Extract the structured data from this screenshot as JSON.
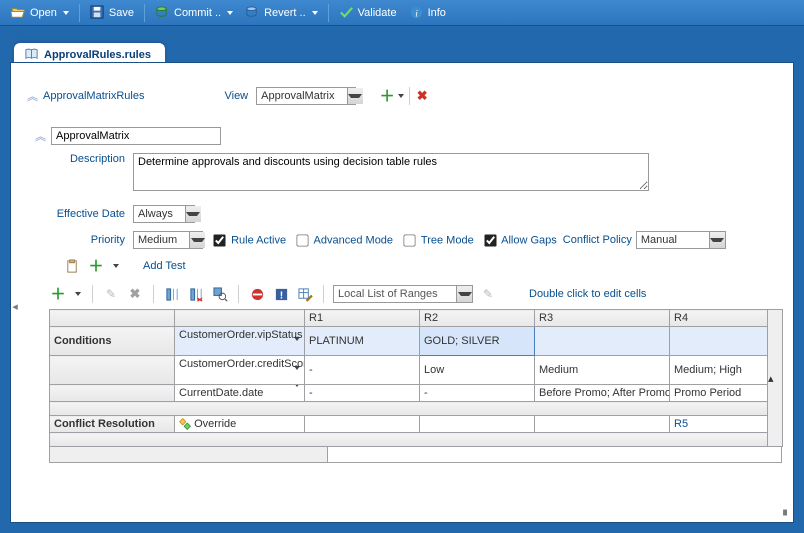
{
  "toolbar": {
    "open": "Open",
    "save": "Save",
    "commit": "Commit ..",
    "revert": "Revert ..",
    "validate": "Validate",
    "info": "Info"
  },
  "tab": {
    "title": "ApprovalRules.rules"
  },
  "header": {
    "ruleset": "ApprovalMatrixRules",
    "view_label": "View",
    "view_value": "ApprovalMatrix"
  },
  "matrix_name": "ApprovalMatrix",
  "desc_label": "Description",
  "description": "Determine approvals and discounts using decision table rules",
  "eff_label": "Effective Date",
  "eff_value": "Always",
  "priority_label": "Priority",
  "priority_value": "Medium",
  "rule_active": "Rule Active",
  "advanced_mode": "Advanced Mode",
  "tree_mode": "Tree Mode",
  "allow_gaps": "Allow Gaps",
  "conflict_policy_label": "Conflict Policy",
  "conflict_policy_value": "Manual",
  "add_test": "Add Test",
  "ranges_value": "Local List of Ranges",
  "dbl_click": "Double click to edit cells",
  "grid": {
    "cols": [
      "",
      "",
      "R1",
      "R2",
      "R3",
      "R4",
      ""
    ],
    "rows": [
      {
        "c0": "Conditions",
        "c1": "CustomerOrder.vipStatus",
        "r1": "PLATINUM",
        "r2": "GOLD; SILVER",
        "r3": "",
        "r4": ""
      },
      {
        "c0": "",
        "c1": "CustomerOrder.creditScore",
        "r1": "-",
        "r2": "Low",
        "r3": "Medium",
        "r4": "Medium; High"
      },
      {
        "c0": "",
        "c1": "CurrentDate.date",
        "r1": "-",
        "r2": "-",
        "r3": "Before Promo; After Promo",
        "r4": "Promo Period"
      }
    ],
    "blank_row": "",
    "conflict_row_label": "Conflict Resolution",
    "override": "Override",
    "r5": "R5"
  }
}
